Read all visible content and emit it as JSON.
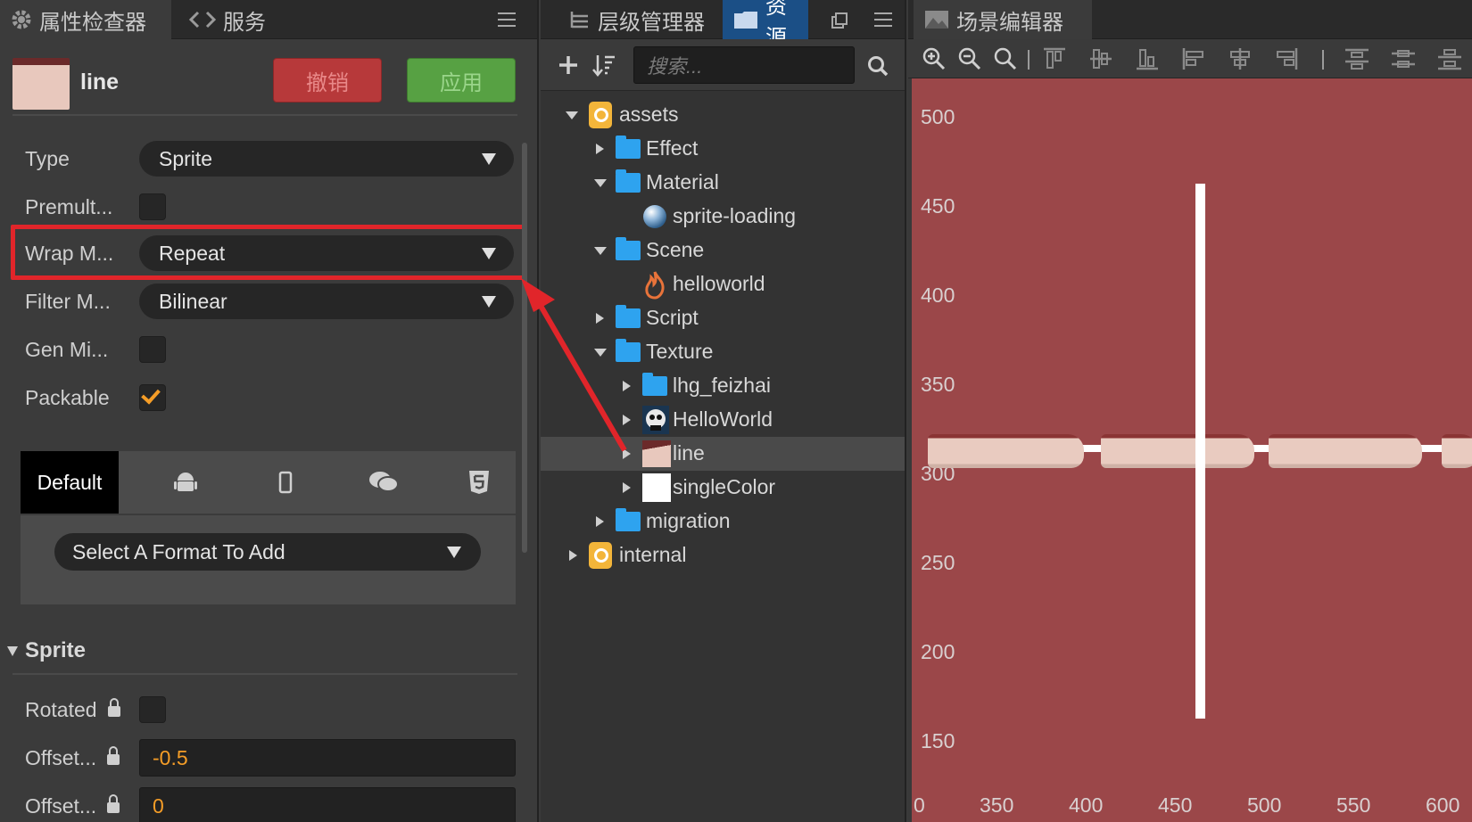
{
  "inspector": {
    "tabs": [
      {
        "label": "属性检查器",
        "icon": "gear-icon"
      },
      {
        "label": "服务",
        "icon": "service-icon"
      }
    ],
    "asset": {
      "name": "line",
      "revert_label": "撤销",
      "apply_label": "应用"
    },
    "props": {
      "type_label": "Type",
      "type_value": "Sprite",
      "premult_label": "Premult...",
      "wrap_label": "Wrap M...",
      "wrap_value": "Repeat",
      "filter_label": "Filter M...",
      "filter_value": "Bilinear",
      "genmip_label": "Gen Mi...",
      "packable_label": "Packable",
      "packable_checked": true
    },
    "platform_tabs": {
      "default_label": "Default",
      "icons": [
        "android-icon",
        "phone-icon",
        "chat-icon",
        "html5-icon"
      ]
    },
    "format_select": "Select A Format To Add",
    "sprite_section": {
      "title": "Sprite",
      "rotated_label": "Rotated",
      "offset_x_label": "Offset...",
      "offset_x_value": "-0.5",
      "offset_y_label": "Offset...",
      "offset_y_value": "0"
    },
    "highlight_color": "#e1252a"
  },
  "assets": {
    "tabs": [
      {
        "label": "层级管理器"
      },
      {
        "label": "资源"
      }
    ],
    "search_placeholder": "搜索...",
    "tree": [
      {
        "label": "assets",
        "icon": "db-icon",
        "expanded": true
      },
      {
        "label": "Effect",
        "icon": "folder-icon",
        "expanded": false
      },
      {
        "label": "Material",
        "icon": "folder-icon",
        "expanded": true
      },
      {
        "label": "sprite-loading",
        "icon": "material-sphere-icon"
      },
      {
        "label": "Scene",
        "icon": "folder-icon",
        "expanded": true
      },
      {
        "label": "helloworld",
        "icon": "scene-flame-icon"
      },
      {
        "label": "Script",
        "icon": "folder-icon",
        "expanded": false
      },
      {
        "label": "Texture",
        "icon": "folder-icon",
        "expanded": true
      },
      {
        "label": "lhg_feizhai",
        "icon": "folder-icon",
        "expanded": false
      },
      {
        "label": "HelloWorld",
        "icon": "image-thumb-icon",
        "expanded": false
      },
      {
        "label": "line",
        "icon": "texture-thumb-icon",
        "expanded": false,
        "selected": true
      },
      {
        "label": "singleColor",
        "icon": "white-texture-icon",
        "expanded": false
      },
      {
        "label": "migration",
        "icon": "folder-icon",
        "expanded": false
      },
      {
        "label": "internal",
        "icon": "db-icon",
        "expanded": false
      }
    ]
  },
  "scene": {
    "tab_label": "场景编辑器",
    "y_ticks": [
      "500",
      "450",
      "400",
      "350",
      "300",
      "250",
      "200",
      "150"
    ],
    "x_ticks": [
      "0",
      "350",
      "400",
      "450",
      "500",
      "550",
      "600"
    ],
    "canvas_color": "#9b4749"
  }
}
